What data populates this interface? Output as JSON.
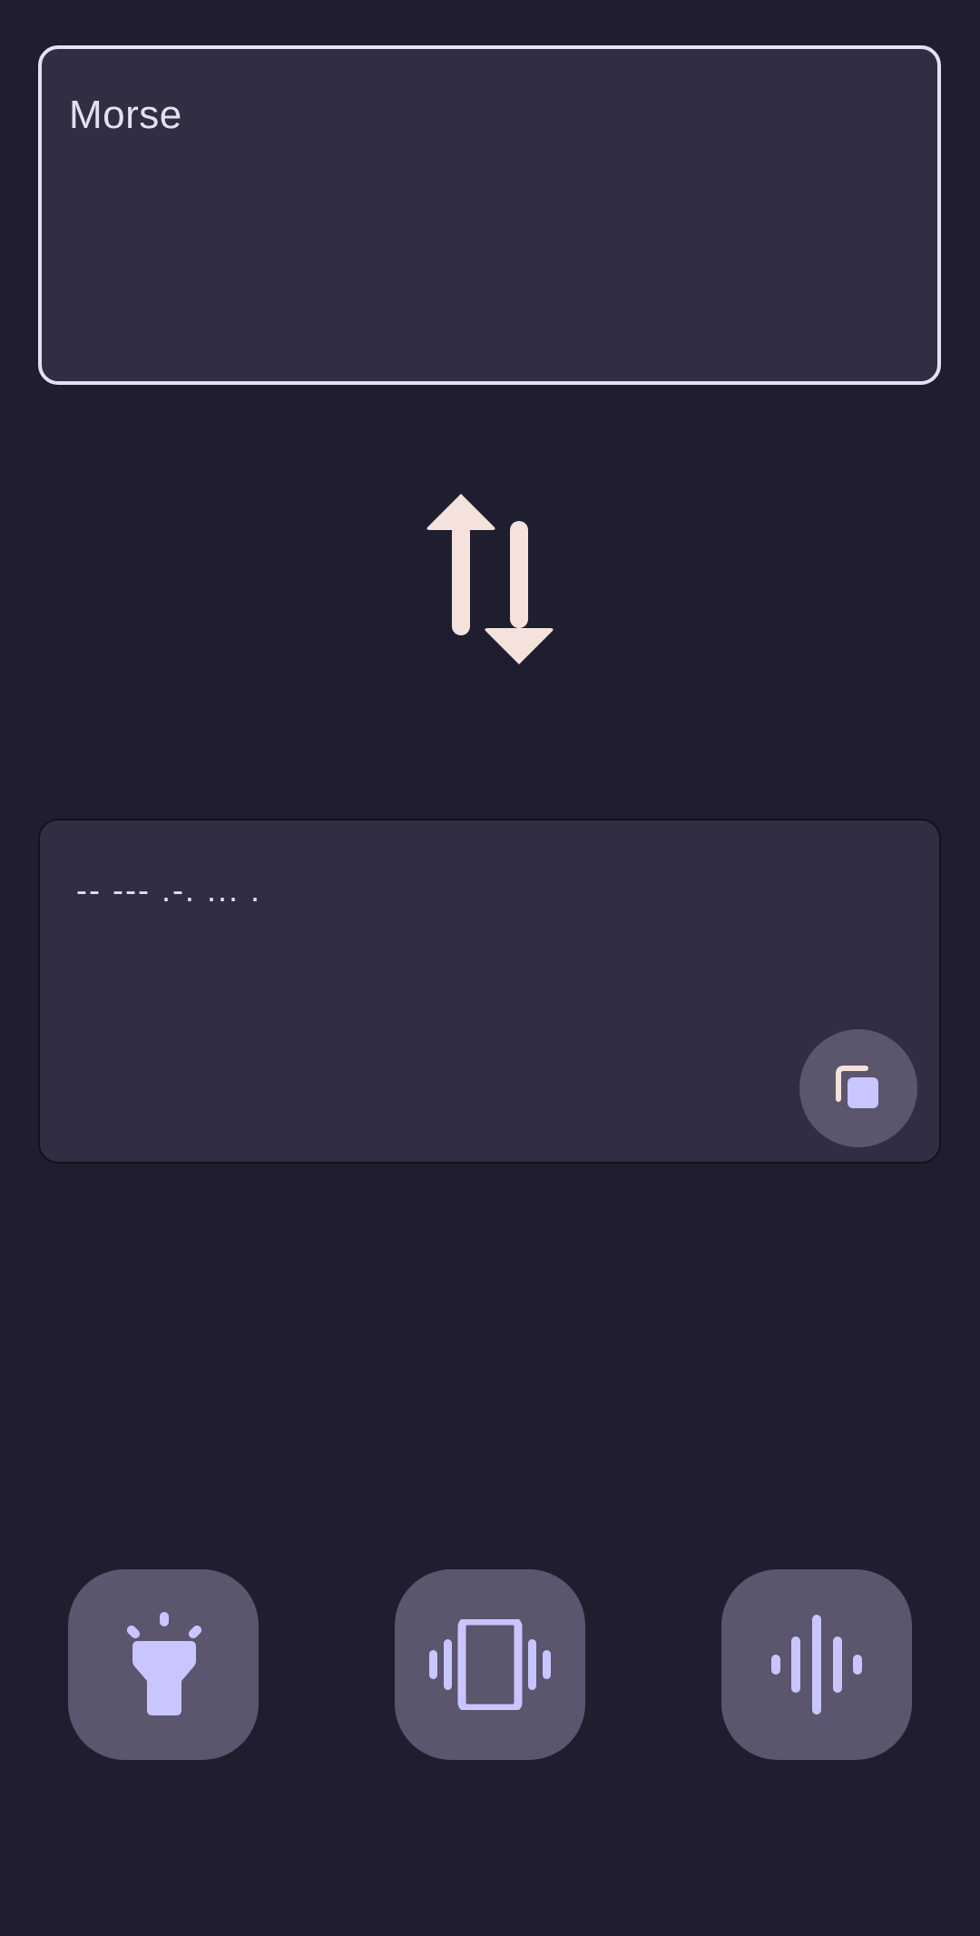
{
  "input": {
    "text": "Morse"
  },
  "output": {
    "text": "-- --- .-. ... ."
  },
  "swap_button": {
    "icon": "swap-vert-icon"
  },
  "copy_button": {
    "icon": "copy-icon"
  },
  "actions": [
    {
      "icon": "flashlight-icon"
    },
    {
      "icon": "vibrate-icon"
    },
    {
      "icon": "sound-wave-icon"
    }
  ],
  "colors": {
    "background": "#1f1e2e",
    "card": "#312e43",
    "input_border": "#e4e1f2",
    "button": "#5b556d",
    "icon_lavender": "#c9c5ff",
    "icon_peach": "#f6e2dc",
    "text": "#e4e1ee"
  }
}
